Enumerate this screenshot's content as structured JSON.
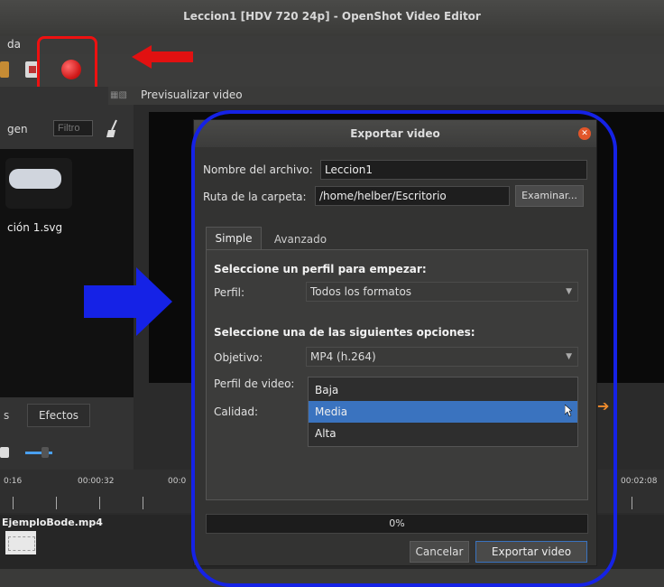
{
  "window": {
    "title": "Leccion1 [HDV 720 24p] - OpenShot Video Editor"
  },
  "menu": {
    "partial_label": "da"
  },
  "left_panel": {
    "label_partial": "gen",
    "filter_placeholder": "Filtro",
    "thumbnail_label": "ción 1.svg",
    "tab_partial": "s",
    "tab_effects": "Efectos"
  },
  "preview": {
    "title": "Previsualizar video"
  },
  "timeline": {
    "ticks": [
      "0:16",
      "00:00:32",
      "00:0",
      "00:02:08"
    ],
    "clip_name": "EjemploBode.mp4"
  },
  "dialog": {
    "title": "Exportar video",
    "filename_label": "Nombre del archivo:",
    "filename_value": "Leccion1",
    "folder_label": "Ruta de la carpeta:",
    "folder_value": "/home/helber/Escritorio",
    "browse_label": "Examinar...",
    "tabs": [
      "Simple",
      "Avanzado"
    ],
    "section1_heading": "Seleccione un perfil para empezar:",
    "profile_label": "Perfil:",
    "profile_value": "Todos los formatos",
    "section2_heading": "Seleccione una de las siguientes opciones:",
    "target_label": "Objetivo:",
    "target_value": "MP4 (h.264)",
    "video_profile_label": "Perfil de video:",
    "quality_label": "Calidad:",
    "quality_options": [
      "Baja",
      "Media",
      "Alta"
    ],
    "quality_selected": "Media",
    "progress_text": "0%",
    "cancel_label": "Cancelar",
    "export_label": "Exportar video"
  },
  "annotations": {
    "highlight_color": "#e11111",
    "frame_color": "#1522e6"
  }
}
